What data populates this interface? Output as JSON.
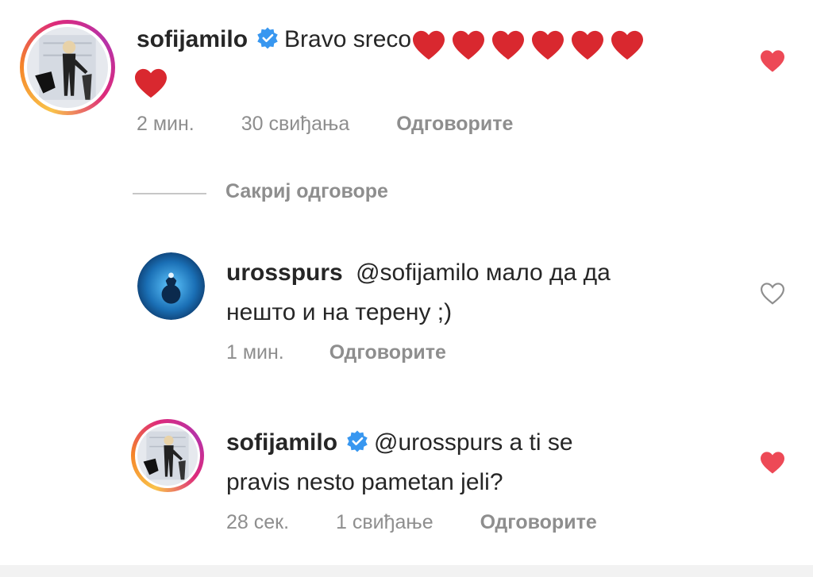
{
  "comments": [
    {
      "username": "sofijamilo",
      "verified": true,
      "text_line1": "Bravo sreco",
      "hearts_line1": 6,
      "hearts_line2": 1,
      "time": "2 мин.",
      "likes": "30 свиђања",
      "reply": "Одговорите",
      "liked": true,
      "avatar": "sofijamilo-avatar"
    },
    {
      "username": "urosspurs",
      "verified": false,
      "text_line1": "@sofijamilo мало да да",
      "text_line2": "нешто и на терену ;)",
      "time": "1 мин.",
      "reply": "Одговорите",
      "liked": false,
      "avatar": "spurs-avatar"
    },
    {
      "username": "sofijamilo",
      "verified": true,
      "text_line1": "@urosspurs a ti se",
      "text_line2": "pravis nesto pametan jeli?",
      "time": "28 сек.",
      "likes": "1 свиђање",
      "reply": "Одговорите",
      "liked": true,
      "avatar": "sofijamilo-avatar"
    }
  ],
  "hide_replies": "Сакриј одговоре",
  "colors": {
    "heart_red": "#ed4956",
    "verified_blue": "#3897f0",
    "meta_gray": "#8e8e8e",
    "text": "#262626"
  }
}
